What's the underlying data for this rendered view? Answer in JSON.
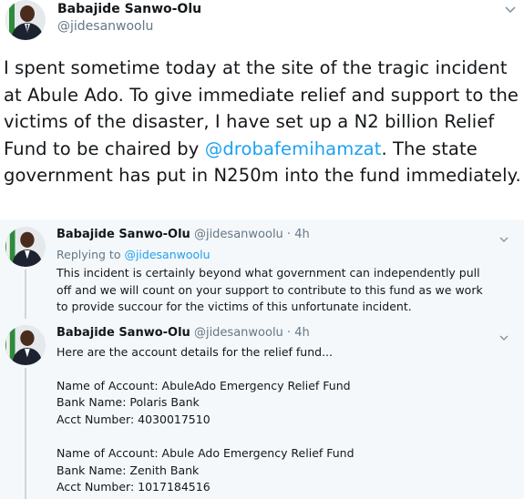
{
  "tweet": {
    "author_name": "Babajide Sanwo-Olu",
    "author_handle": "@jidesanwoolu",
    "text_part1": "I spent sometime today at the site of the tragic incident at Abule Ado. To give immediate relief and support to the victims of the disaster, I have set up a N2 billion Relief Fund to be chaired by ",
    "mention": "@drobafemihamzat",
    "text_part2": ". The state government has put in N250m into the fund immediately."
  },
  "replies": [
    {
      "author_name": "Babajide Sanwo-Olu",
      "meta": "@jidesanwoolu · 4h",
      "replying_prefix": "Replying to ",
      "replying_to": "@jidesanwoolu",
      "lines": [
        "This incident is certainly beyond what government can independently pull",
        "off and we will count on your support to contribute to this fund as we work",
        "to provide succour for the victims of this unfortunate incident."
      ]
    },
    {
      "author_name": "Babajide Sanwo-Olu",
      "meta": "@jidesanwoolu · 4h",
      "lines": [
        "Here are the account details for the relief fund...",
        "",
        "Name of Account: AbuleAdo Emergency Relief Fund",
        "Bank Name: Polaris Bank",
        "Acct Number: 4030017510",
        "",
        "Name of Account: Abule Ado Emergency Relief Fund",
        "Bank Name: Zenith Bank",
        "Acct Number: 1017184516"
      ]
    }
  ],
  "colors": {
    "mention": "#1da1f2",
    "thread_bg": "#f5f8fa",
    "muted": "#657786"
  },
  "icons": {
    "menu": "chevron-down-icon",
    "avatar": "avatar"
  }
}
